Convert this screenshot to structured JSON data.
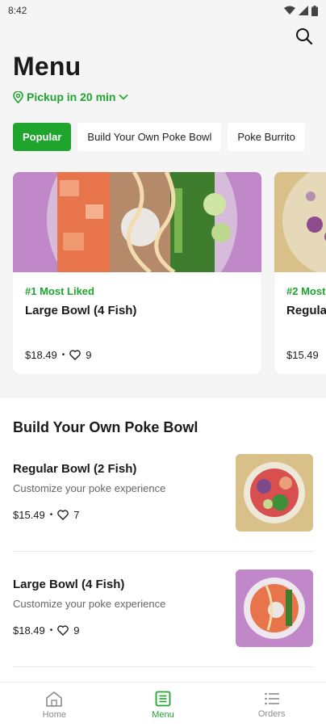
{
  "status": {
    "time": "8:42"
  },
  "header": {
    "title": "Menu",
    "pickup": "Pickup in 20 min"
  },
  "chips": [
    {
      "label": "Popular",
      "active": true
    },
    {
      "label": "Build Your Own Poke Bowl",
      "active": false
    },
    {
      "label": "Poke Burrito",
      "active": false
    }
  ],
  "popular_cards": [
    {
      "tag": "#1 Most Liked",
      "name": "Large Bowl (4 Fish)",
      "price": "$18.49",
      "likes": "9"
    },
    {
      "tag": "#2 Most",
      "name": "Regula",
      "price": "$15.49",
      "likes": ""
    }
  ],
  "section": {
    "title": "Build Your Own Poke Bowl",
    "items": [
      {
        "name": "Regular Bowl (2 Fish)",
        "desc": "Customize your poke experience",
        "price": "$15.49",
        "likes": "7"
      },
      {
        "name": "Large Bowl (4 Fish)",
        "desc": "Customize your poke experience",
        "price": "$18.49",
        "likes": "9"
      }
    ]
  },
  "bottom_nav": [
    {
      "label": "Home",
      "icon": "home-icon",
      "active": false
    },
    {
      "label": "Menu",
      "icon": "menu-icon",
      "active": true
    },
    {
      "label": "Orders",
      "icon": "orders-icon",
      "active": false
    }
  ],
  "colors": {
    "accent": "#1fa52e",
    "card_bg_purple": "#c088c8",
    "card_bg_tan": "#d9c089"
  }
}
